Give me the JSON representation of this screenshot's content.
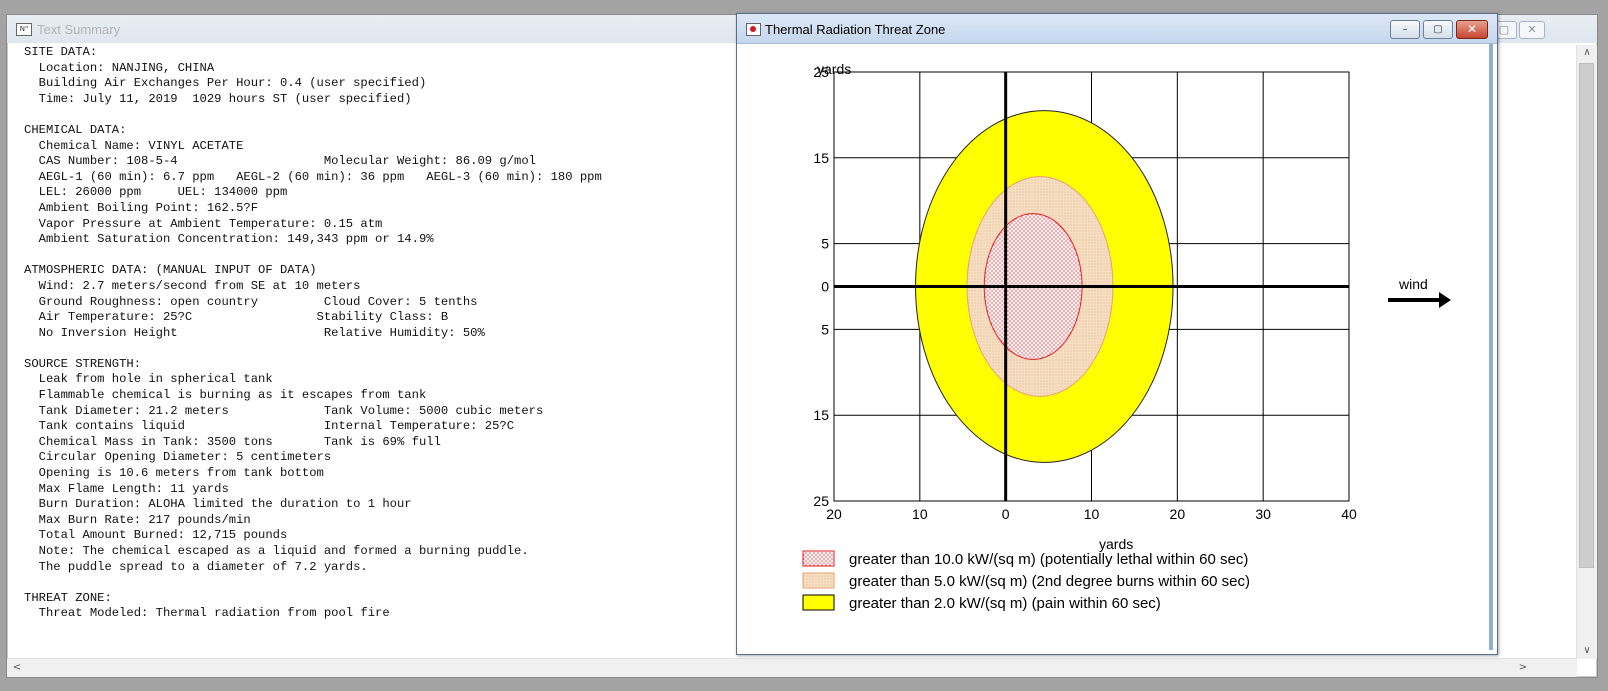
{
  "text_summary_window": {
    "title": "Text Summary",
    "icon_glyph": "N\"",
    "controls": [
      "–",
      "▢",
      "✕"
    ],
    "scroll_up": "∧",
    "scroll_down": "∨",
    "scroll_left": "<",
    "scroll_right": ">",
    "lines": [
      "SITE DATA:",
      "  Location: NANJING, CHINA",
      "  Building Air Exchanges Per Hour: 0.4 (user specified)",
      "  Time: July 11, 2019  1029 hours ST (user specified)",
      "",
      "CHEMICAL DATA:",
      "  Chemical Name: VINYL ACETATE",
      "  CAS Number: 108-5-4                    Molecular Weight: 86.09 g/mol",
      "  AEGL-1 (60 min): 6.7 ppm   AEGL-2 (60 min): 36 ppm   AEGL-3 (60 min): 180 ppm",
      "  LEL: 26000 ppm     UEL: 134000 ppm",
      "  Ambient Boiling Point: 162.5?F",
      "  Vapor Pressure at Ambient Temperature: 0.15 atm",
      "  Ambient Saturation Concentration: 149,343 ppm or 14.9%",
      "",
      "ATMOSPHERIC DATA: (MANUAL INPUT OF DATA)",
      "  Wind: 2.7 meters/second from SE at 10 meters",
      "  Ground Roughness: open country         Cloud Cover: 5 tenths",
      "  Air Temperature: 25?C                 Stability Class: B",
      "  No Inversion Height                    Relative Humidity: 50%",
      "",
      "SOURCE STRENGTH:",
      "  Leak from hole in spherical tank",
      "  Flammable chemical is burning as it escapes from tank",
      "  Tank Diameter: 21.2 meters             Tank Volume: 5000 cubic meters",
      "  Tank contains liquid                   Internal Temperature: 25?C",
      "  Chemical Mass in Tank: 3500 tons       Tank is 69% full",
      "  Circular Opening Diameter: 5 centimeters",
      "  Opening is 10.6 meters from tank bottom",
      "  Max Flame Length: 11 yards",
      "  Burn Duration: ALOHA limited the duration to 1 hour",
      "  Max Burn Rate: 217 pounds/min",
      "  Total Amount Burned: 12,715 pounds",
      "  Note: The chemical escaped as a liquid and formed a burning puddle.",
      "  The puddle spread to a diameter of 7.2 yards.",
      "",
      "THREAT ZONE:",
      "  Threat Modeled: Thermal radiation from pool fire"
    ]
  },
  "thermal_window": {
    "title": "Thermal Radiation Threat Zone",
    "controls": {
      "minimize": "–",
      "maximize": "▢",
      "close": "✕"
    },
    "wind_label": "wind",
    "colors": {
      "zone_red_border": "#e0202a",
      "zone_red_dots": "#d81c1c",
      "zone_orange": "#f5d9b4",
      "zone_orange_border": "#e8a070",
      "zone_yellow": "#ffff00"
    }
  },
  "chart_data": {
    "type": "threat-zone-plot",
    "xlabel": "yards",
    "ylabel": "yards",
    "x_ticks": [
      "20",
      "10",
      "0",
      "10",
      "20",
      "30",
      "40"
    ],
    "x_values": [
      -20,
      -10,
      0,
      10,
      20,
      30,
      40
    ],
    "y_ticks": [
      "25",
      "15",
      "5",
      "0",
      "5",
      "15",
      "25"
    ],
    "y_values": [
      25,
      15,
      5,
      0,
      -5,
      -15,
      -25
    ],
    "xlim": [
      -20,
      40
    ],
    "ylim": [
      -25,
      25
    ],
    "grid": true,
    "zones": [
      {
        "name": "greater than 2.0 kW/(sq m) (pain within 60 sec)",
        "color": "#ffff00",
        "fill": "solid",
        "center_x": 4.5,
        "center_y": 0,
        "radius_x": 15.0,
        "radius_y": 20.5
      },
      {
        "name": "greater than 5.0 kW/(sq m) (2nd degree burns within 60 sec)",
        "color": "#f5d9b4",
        "fill": "dotted",
        "center_x": 4.0,
        "center_y": 0,
        "radius_x": 8.5,
        "radius_y": 12.8
      },
      {
        "name": "greater than 10.0 kW/(sq m) (potentially lethal within 60 sec)",
        "color": "#e0202a",
        "fill": "dotted",
        "center_x": 3.2,
        "center_y": 0,
        "radius_x": 5.7,
        "radius_y": 8.5
      }
    ],
    "legend": [
      {
        "label": "greater than 10.0 kW/(sq m) (potentially lethal within 60 sec)",
        "swatch": "red-dotted"
      },
      {
        "label": "greater than 5.0 kW/(sq m) (2nd degree burns within 60 sec)",
        "swatch": "orange-dotted"
      },
      {
        "label": "greater than 2.0 kW/(sq m) (pain within 60 sec)",
        "swatch": "yellow-solid"
      }
    ],
    "legend_position": "bottom"
  }
}
